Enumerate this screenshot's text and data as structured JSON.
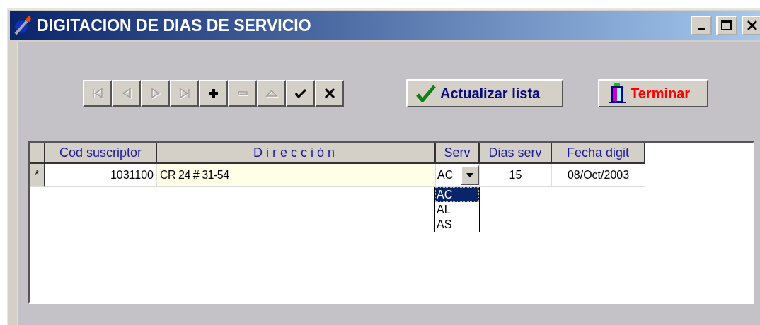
{
  "window": {
    "title": "DIGITACION DE DIAS DE SERVICIO"
  },
  "navigator": [
    {
      "kind": "first",
      "disabled": true
    },
    {
      "kind": "prev",
      "disabled": true
    },
    {
      "kind": "next",
      "disabled": true
    },
    {
      "kind": "last",
      "disabled": true
    },
    {
      "kind": "add",
      "disabled": false
    },
    {
      "kind": "delete",
      "disabled": true
    },
    {
      "kind": "up",
      "disabled": true
    },
    {
      "kind": "confirm",
      "disabled": false
    },
    {
      "kind": "cancel",
      "disabled": false
    }
  ],
  "buttons": [
    {
      "kind": "refresh",
      "label": "Actualizar lista"
    },
    {
      "kind": "exit",
      "label": "Terminar"
    }
  ],
  "table": {
    "columns": [
      "Cod suscriptor",
      "Dirección",
      "Serv",
      "Dias serv",
      "Fecha digit"
    ],
    "rows": [
      {
        "marker": "*",
        "cells": [
          "1031100",
          "CR 24 # 31-54",
          "AC",
          "15",
          "08/Oct/2003"
        ]
      }
    ],
    "dropdown": [
      {
        "label": "AC",
        "selected": true
      },
      {
        "label": "AL",
        "selected": false
      },
      {
        "label": "AS",
        "selected": false
      }
    ]
  }
}
